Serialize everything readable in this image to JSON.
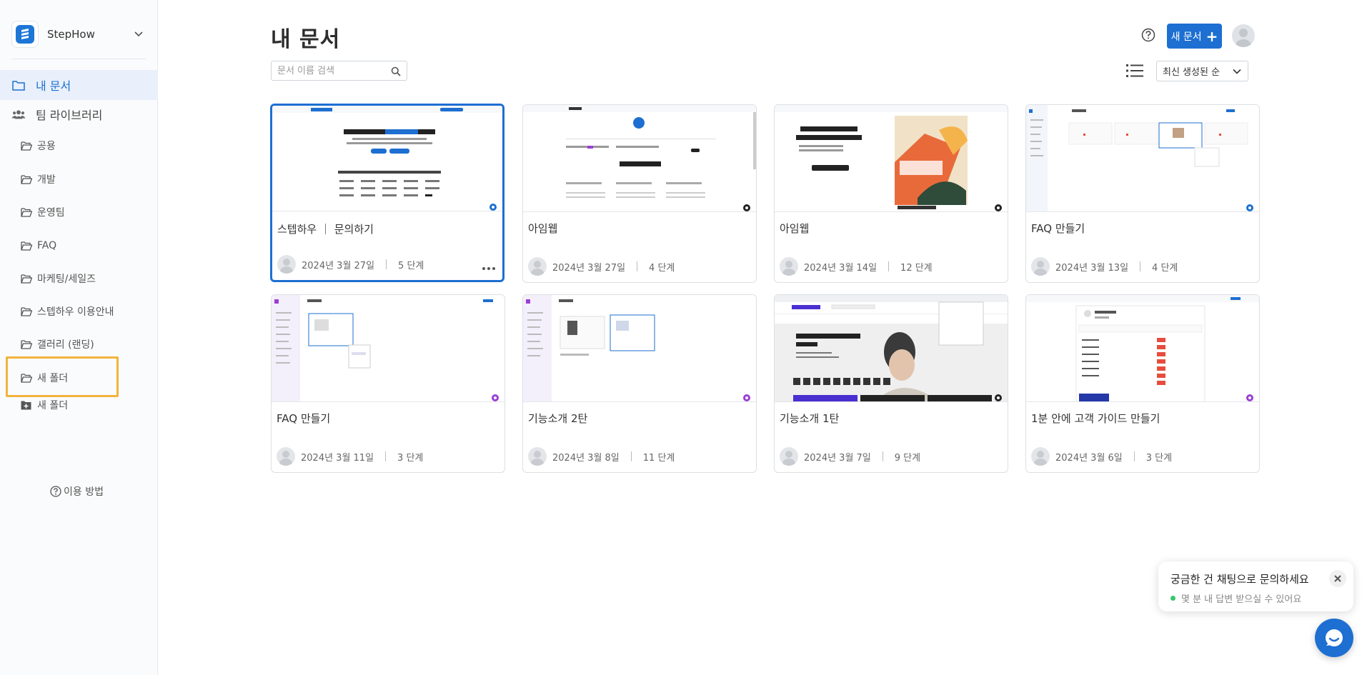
{
  "sidebar": {
    "workspace_name": "StepHow",
    "my_docs": "내 문서",
    "team_library": "팀 라이브러리",
    "folders": [
      {
        "label": "공용"
      },
      {
        "label": "개발"
      },
      {
        "label": "운영팀"
      },
      {
        "label": "FAQ"
      },
      {
        "label": "마케팅/세일즈"
      },
      {
        "label": "스텝하우 이용안내"
      },
      {
        "label": "갤러리 (랜딩)"
      },
      {
        "label": "새 폴더"
      }
    ],
    "add_folder": "새 폴더",
    "help": "이용 방법"
  },
  "header": {
    "title": "내 문서",
    "search_placeholder": "문서 이름 검색",
    "new_doc": "새 문서",
    "sort": "최신 생성된 순"
  },
  "documents": [
    {
      "title": "스텝하우 ｜ 문의하기",
      "date": "2024년 3월 27일",
      "steps": "5 단계",
      "badge_color": "#1d6fd1"
    },
    {
      "title": "아임웹",
      "date": "2024년 3월 27일",
      "steps": "4 단계",
      "badge_color": "#222222"
    },
    {
      "title": "아임웹",
      "date": "2024년 3월 14일",
      "steps": "12 단계",
      "badge_color": "#222222"
    },
    {
      "title": "FAQ 만들기",
      "date": "2024년 3월 13일",
      "steps": "4 단계",
      "badge_color": "#1d6fd1"
    },
    {
      "title": "FAQ 만들기",
      "date": "2024년 3월 11일",
      "steps": "3 단계",
      "badge_color": "#9b3fd1"
    },
    {
      "title": "기능소개 2탄",
      "date": "2024년 3월 8일",
      "steps": "11 단계",
      "badge_color": "#9b3fd1"
    },
    {
      "title": "기능소개 1탄",
      "date": "2024년 3월 7일",
      "steps": "9 단계",
      "badge_color": "#222222"
    },
    {
      "title": "1분 안에 고객 가이드 만들기",
      "date": "2024년 3월 6일",
      "steps": "3 단계",
      "badge_color": "#9b3fd1"
    }
  ],
  "chat": {
    "title": "궁금한 건 채팅으로 문의하세요",
    "subtitle": "몇 분 내 답변 받으실 수 있어요"
  },
  "colors": {
    "accent": "#1d6fd1",
    "highlight": "#f3b33d"
  }
}
